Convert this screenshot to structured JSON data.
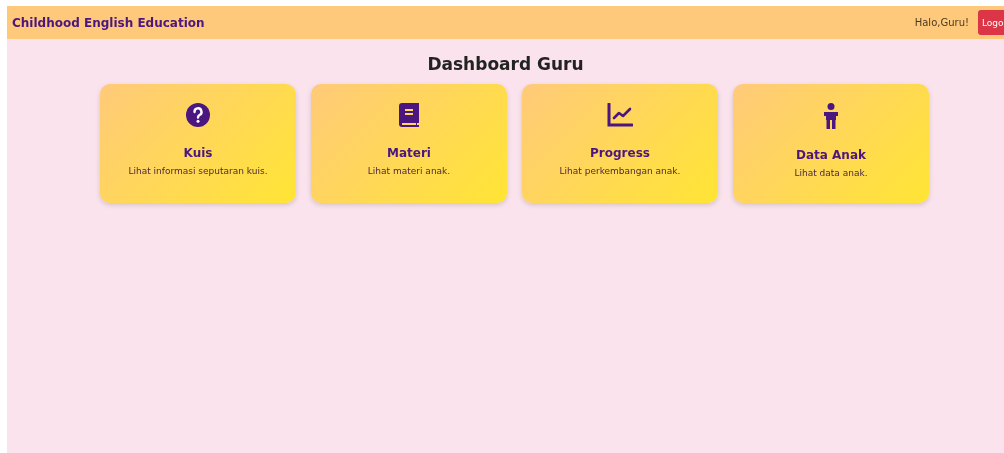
{
  "navbar": {
    "brand": "Childhood English Education",
    "greeting": "Halo,Guru!",
    "logout_button": "Logo"
  },
  "title": "Dashboard Guru",
  "cards": [
    {
      "kind": "quiz",
      "title": "Kuis",
      "description": "Lihat informasi seputaran kuis."
    },
    {
      "kind": "book",
      "title": "Materi",
      "description": "Lihat materi anak."
    },
    {
      "kind": "chart",
      "title": "Progress",
      "description": "Lihat perkembangan anak."
    },
    {
      "kind": "child",
      "title": "Data Anak",
      "description": "Lihat data anak."
    }
  ]
}
